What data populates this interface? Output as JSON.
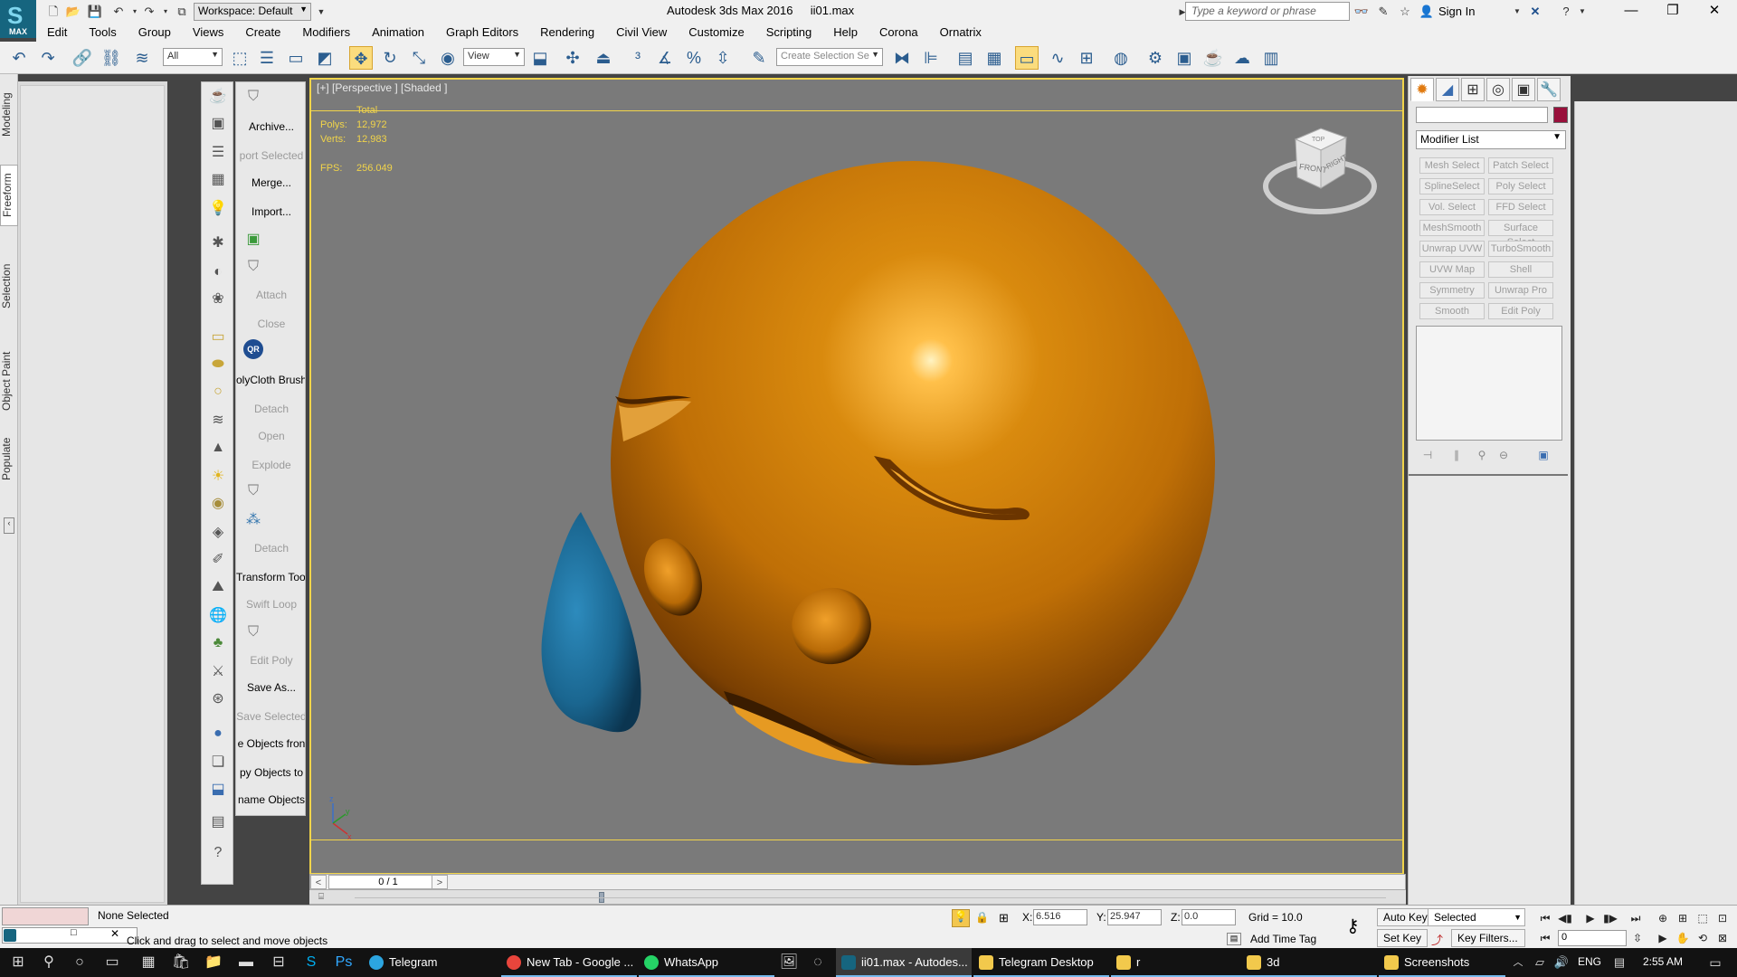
{
  "title_bar": {
    "logo_label": "MAX",
    "workspace": "Workspace: Default",
    "app_title": "Autodesk 3ds Max 2016",
    "file_name": "ii01.max",
    "search_placeholder": "Type a keyword or phrase",
    "sign_in": "Sign In"
  },
  "menu": [
    "Edit",
    "Tools",
    "Group",
    "Views",
    "Create",
    "Modifiers",
    "Animation",
    "Graph Editors",
    "Rendering",
    "Civil View",
    "Customize",
    "Scripting",
    "Help",
    "Corona",
    "Ornatrix"
  ],
  "toolbar": {
    "selection_filter": "All",
    "ref_coord": "View",
    "selection_set_placeholder": "Create Selection Se"
  },
  "ribbon_tabs": [
    "Modeling",
    "Freeform",
    "Selection",
    "Object Paint",
    "Populate"
  ],
  "tool_panel": {
    "items": [
      {
        "label": "Archive...",
        "enabled": true
      },
      {
        "label": "port Selected",
        "enabled": false
      },
      {
        "label": "Merge...",
        "enabled": true
      },
      {
        "label": "Import...",
        "enabled": true
      },
      {
        "label": "Attach",
        "enabled": false
      },
      {
        "label": "Close",
        "enabled": false
      },
      {
        "label": "olyCloth Brushe",
        "enabled": true
      },
      {
        "label": "Detach",
        "enabled": false
      },
      {
        "label": "Open",
        "enabled": false
      },
      {
        "label": "Explode",
        "enabled": false
      },
      {
        "label": "Detach",
        "enabled": false
      },
      {
        "label": "Transform Tool",
        "enabled": true
      },
      {
        "label": "Swift Loop",
        "enabled": false
      },
      {
        "label": "Edit Poly",
        "enabled": false
      },
      {
        "label": "Save As...",
        "enabled": true
      },
      {
        "label": "Save Selected",
        "enabled": false
      },
      {
        "label": "e Objects fron",
        "enabled": true
      },
      {
        "label": "py Objects to",
        "enabled": true
      },
      {
        "label": "name Objects",
        "enabled": true
      }
    ],
    "qr_badge": "QR"
  },
  "viewport": {
    "label": "[+] [Perspective ] [Shaded ]",
    "stats": {
      "header": "Total",
      "polys_label": "Polys:",
      "polys": "12,972",
      "verts_label": "Verts:",
      "verts": "12,983",
      "fps_label": "FPS:",
      "fps": "256.049"
    },
    "viewcube": {
      "front": "FRONT",
      "right": "RIGHT",
      "top": "TOP"
    },
    "axis": {
      "z": "z",
      "y": "y",
      "x": "x"
    },
    "colors": {
      "sphere": "#d27f0a",
      "drop": "#1f6f95",
      "background": "#7a7a7a",
      "border": "#f1d44a"
    }
  },
  "command_panel": {
    "modifier_list": "Modifier List",
    "modifiers": [
      "Mesh Select",
      "Patch Select",
      "SplineSelect",
      "Poly Select",
      "Vol. Select",
      "FFD Select",
      "MeshSmooth",
      "Surface Select",
      "Unwrap UVW",
      "TurboSmooth",
      "UVW Map",
      "Shell",
      "Symmetry",
      "Unwrap Pro",
      "Smooth",
      "Edit Poly"
    ],
    "color_swatch": "#99103b"
  },
  "time_slider": {
    "frame": "0 / 1"
  },
  "status": {
    "selection": "None Selected",
    "prompt": "Click and drag to select and move objects",
    "x_label": "X:",
    "x": "6.516",
    "y_label": "Y:",
    "y": "25.947",
    "z_label": "Z:",
    "z": "0.0",
    "grid": "Grid = 10.0",
    "add_time_tag": "Add Time Tag",
    "auto_key": "Auto Key",
    "set_key": "Set Key",
    "selected_dropdown": "Selected",
    "key_filters": "Key Filters...",
    "frame_field": "0"
  },
  "taskbar": {
    "apps": [
      {
        "label": "Telegram",
        "color": "#2ca5e0"
      },
      {
        "label": "New Tab - Google ...",
        "color": "#e8453c"
      },
      {
        "label": "WhatsApp",
        "color": "#25d366"
      },
      {
        "label": "ii01.max - Autodes...",
        "color": "#16657f"
      },
      {
        "label": "Telegram Desktop",
        "color": "#f2c94c"
      },
      {
        "label": "r",
        "color": "#f2c94c"
      },
      {
        "label": "3d",
        "color": "#f2c94c"
      },
      {
        "label": "Screenshots",
        "color": "#f2c94c"
      }
    ],
    "language": "ENG",
    "time": "2:55 AM"
  }
}
